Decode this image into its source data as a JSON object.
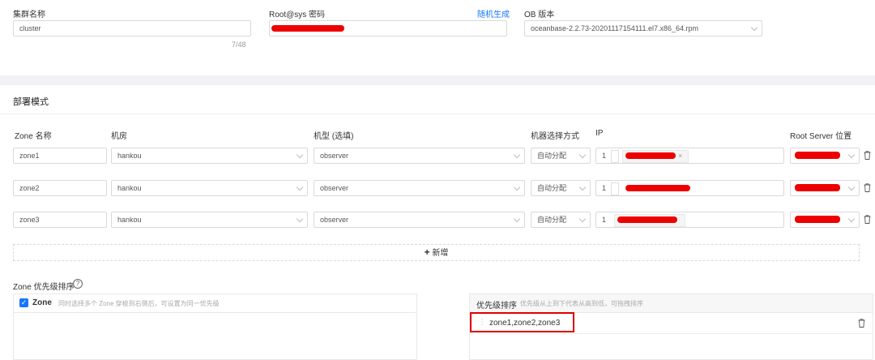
{
  "cluster": {
    "name_label": "集群名称",
    "name_value": "cluster",
    "name_count": "7/48"
  },
  "password": {
    "label": "Root@sys 密码",
    "generate_link": "随机生成"
  },
  "version": {
    "label": "OB 版本",
    "value": "oceanbase-2.2.73-20201117154111.el7.x86_64.rpm"
  },
  "deploy": {
    "section_title": "部署模式",
    "headers": {
      "zone": "Zone 名称",
      "idc": "机房",
      "model": "机型 (选填)",
      "select_mode": "机器选择方式",
      "ip": "IP",
      "root_server": "Root Server 位置"
    },
    "rows": [
      {
        "zone": "zone1",
        "idc": "hankou",
        "model": "observer",
        "select_mode": "自动分配",
        "count": "1"
      },
      {
        "zone": "zone2",
        "idc": "hankou",
        "model": "observer",
        "select_mode": "自动分配",
        "count": "1"
      },
      {
        "zone": "zone3",
        "idc": "hankou",
        "model": "observer",
        "select_mode": "自动分配",
        "count": "1"
      }
    ],
    "add_label": "新增"
  },
  "priority": {
    "title": "Zone 优先级排序",
    "left_header": "Zone",
    "left_hint": "同时选择多个 Zone 穿梭到右侧后，可设置为同一优先级",
    "right_header": "优先级排序",
    "right_hint": "优先级从上到下代表从高到低，可拖拽排序",
    "item": "zone1,zone2,zone3"
  },
  "colors": {
    "accent": "#1677ff",
    "redaction": "#ee0000",
    "highlight": "#e00000"
  }
}
